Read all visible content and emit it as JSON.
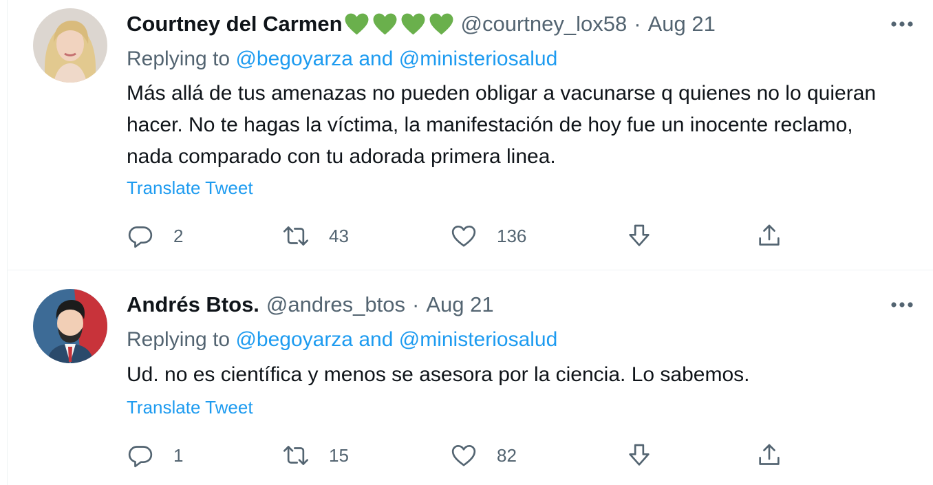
{
  "tweets": [
    {
      "name": "Courtney del Carmen",
      "badges": [
        "green-heart",
        "green-heart",
        "green-heart",
        "green-heart"
      ],
      "handle": "@courtney_lox58",
      "separator": "·",
      "date": "Aug 21",
      "replying_prefix": "Replying to",
      "mention1": "@begoyarza",
      "and": "and",
      "mention2": "@ministeriosalud",
      "text": "Más allá de tus amenazas no pueden obligar a vacunarse q quienes no lo quieran hacer. No te hagas la víctima, la manifestación de hoy fue un inocente reclamo, nada comparado con tu adorada primera linea.",
      "translate": "Translate Tweet",
      "replies": "2",
      "retweets": "43",
      "likes": "136"
    },
    {
      "name": "Andrés Btos.",
      "handle": "@andres_btos",
      "separator": "·",
      "date": "Aug 21",
      "replying_prefix": "Replying to",
      "mention1": "@begoyarza",
      "and": "and",
      "mention2": "@ministeriosalud",
      "text": "Ud. no es científica y menos se asesora por la ciencia. Lo sabemos.",
      "translate": "Translate Tweet",
      "replies": "1",
      "retweets": "15",
      "likes": "82"
    }
  ],
  "colors": {
    "link": "#1d9bf0",
    "secondary_text": "#536471",
    "primary_text": "#0f1419",
    "badge_green": "#6ab04c",
    "divider": "#eff3f4"
  },
  "icons": [
    "reply-icon",
    "retweet-icon",
    "like-icon",
    "downvote-icon",
    "share-icon",
    "more-icon"
  ]
}
